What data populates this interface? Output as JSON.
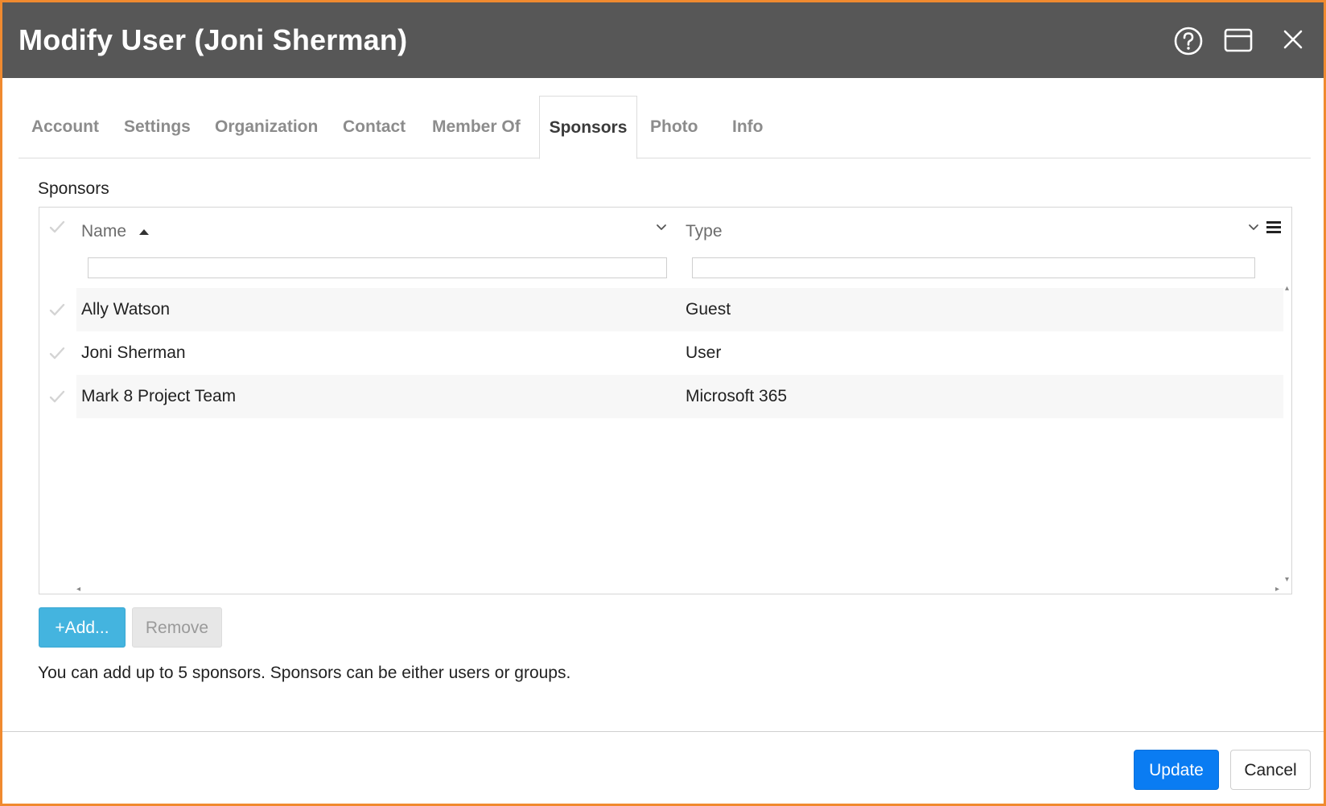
{
  "dialog": {
    "title": "Modify User (Joni Sherman)",
    "icons": [
      "help-icon",
      "window-icon",
      "close-icon"
    ]
  },
  "tabs": [
    {
      "label": "Account",
      "active": false
    },
    {
      "label": "Settings",
      "active": false
    },
    {
      "label": "Organization",
      "active": false
    },
    {
      "label": "Contact",
      "active": false
    },
    {
      "label": "Member Of",
      "active": false
    },
    {
      "label": "Sponsors",
      "active": true
    },
    {
      "label": "Photo",
      "active": false
    },
    {
      "label": "Info",
      "active": false
    }
  ],
  "sponsors": {
    "section_label": "Sponsors",
    "columns": [
      {
        "label": "Name",
        "sort": "ascending"
      },
      {
        "label": "Type"
      }
    ],
    "filters": {
      "name": "",
      "type": ""
    },
    "rows": [
      {
        "name": "Ally Watson",
        "type": "Guest"
      },
      {
        "name": "Joni Sherman",
        "type": "User"
      },
      {
        "name": "Mark 8 Project Team",
        "type": "Microsoft 365"
      }
    ],
    "add_label": "+Add...",
    "remove_label": "Remove",
    "hint": "You can add up to 5 sponsors. Sponsors can be either users or groups."
  },
  "footer": {
    "update_label": "Update",
    "cancel_label": "Cancel"
  },
  "colors": {
    "title_bar": "#575757",
    "frame_accent": "#f08a2f",
    "add_button": "#44b4df",
    "update_button": "#0a7cf2"
  }
}
